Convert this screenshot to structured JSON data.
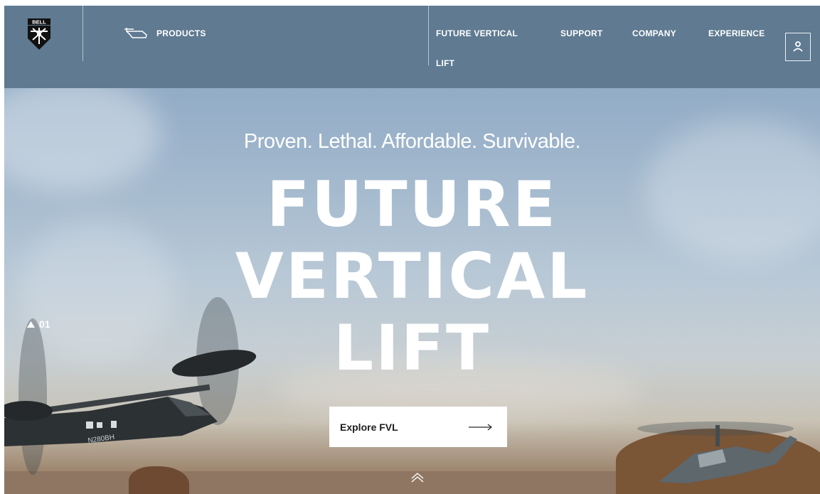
{
  "header": {
    "logo_text": "BELL",
    "products_label": "PRODUCTS",
    "nav": [
      {
        "label": "FUTURE VERTICAL"
      },
      {
        "label": "LIFT"
      },
      {
        "label": "SUPPORT"
      },
      {
        "label": "COMPANY"
      },
      {
        "label": "EXPERIENCE"
      }
    ]
  },
  "hero": {
    "tagline": "Proven. Lethal. Affordable. Survivable.",
    "title_lines": [
      "FUTURE",
      "VERTICAL",
      "LIFT"
    ],
    "cta_label": "Explore FVL",
    "slide_number": "01",
    "aircraft_tail": "N280BH"
  },
  "colors": {
    "header_bg": "#5f7a91",
    "sky": "#86a2bf",
    "text": "#ffffff"
  }
}
